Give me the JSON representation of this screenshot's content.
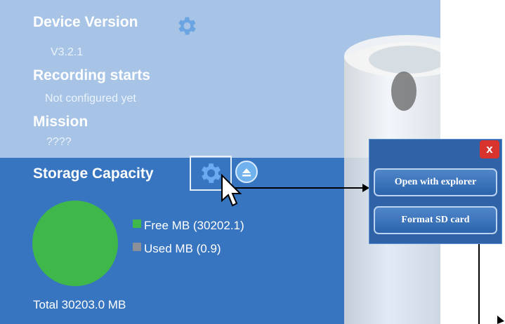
{
  "device": {
    "version_heading": "Device Version",
    "version_value": "V3.2.1",
    "recording_heading": "Recording starts",
    "recording_value": "Not configured yet",
    "mission_heading": "Mission",
    "mission_value": "????"
  },
  "storage": {
    "heading": "Storage Capacity",
    "legend": [
      {
        "label": "Free MB (30202.1)",
        "color": "#3fb74a"
      },
      {
        "label": "Used MB (0.9)",
        "color": "#8a8f98"
      }
    ],
    "total": "Total 30203.0 MB"
  },
  "popup": {
    "close_label": "x",
    "open_explorer_label": "Open with explorer",
    "format_sd_label": "Format SD card"
  },
  "icons": {
    "settings": "gear-icon",
    "eject": "eject-icon",
    "cursor": "mouse-pointer-icon",
    "close": "close-icon"
  },
  "colors": {
    "panel_top": "#a7c4e6",
    "panel_bottom": "#3875c0",
    "free": "#3fb74a",
    "used": "#8a8f98",
    "close": "#d8332d"
  },
  "chart_data": {
    "type": "pie",
    "title": "",
    "series": [
      {
        "name": "Free MB",
        "value": 30202.1
      },
      {
        "name": "Used MB",
        "value": 0.9
      }
    ]
  }
}
